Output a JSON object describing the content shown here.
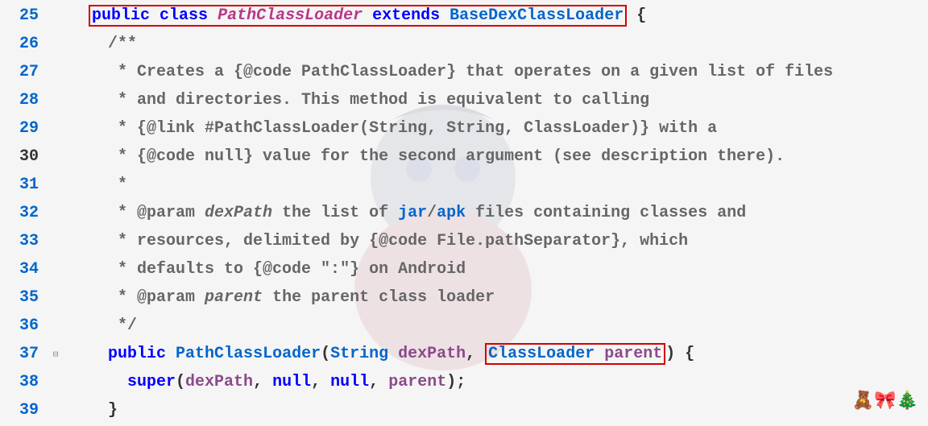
{
  "lines": {
    "25": "25",
    "26": "26",
    "27": "27",
    "28": "28",
    "29": "29",
    "30": "30",
    "31": "31",
    "32": "32",
    "33": "33",
    "34": "34",
    "35": "35",
    "36": "36",
    "37": "37",
    "38": "38",
    "39": "39"
  },
  "kw": {
    "public": "public",
    "class": "class",
    "extends": "extends",
    "null": "null",
    "super": "super"
  },
  "types": {
    "PathClassLoader": "PathClassLoader",
    "BaseDexClassLoader": "BaseDexClassLoader",
    "String": "String",
    "ClassLoader": "ClassLoader"
  },
  "params": {
    "dexPath": "dexPath",
    "parent": "parent"
  },
  "comments": {
    "open": "/**",
    "l27": " * Creates a {@code PathClassLoader} that operates on a given list of files",
    "l28": " * and directories. This method is equivalent to calling",
    "l29": " * {@link #PathClassLoader(String, String, ClassLoader)} with a",
    "l30": " * {@code null} value for the second argument (see description there).",
    "l31": " *",
    "l32a": " * @param ",
    "l32b": " the list of ",
    "l32c": " files containing classes and",
    "l33": " * resources, delimited by {@code File.pathSeparator}, which",
    "l34": " * defaults to {@code \":\"} on Android",
    "l35a": " * @param ",
    "l35b": " the parent class loader",
    "close": " */",
    "jar": "jar",
    "apk": "apk",
    "slash": "/"
  },
  "fold": "⊟",
  "sticker": "🧸🎀🎄"
}
